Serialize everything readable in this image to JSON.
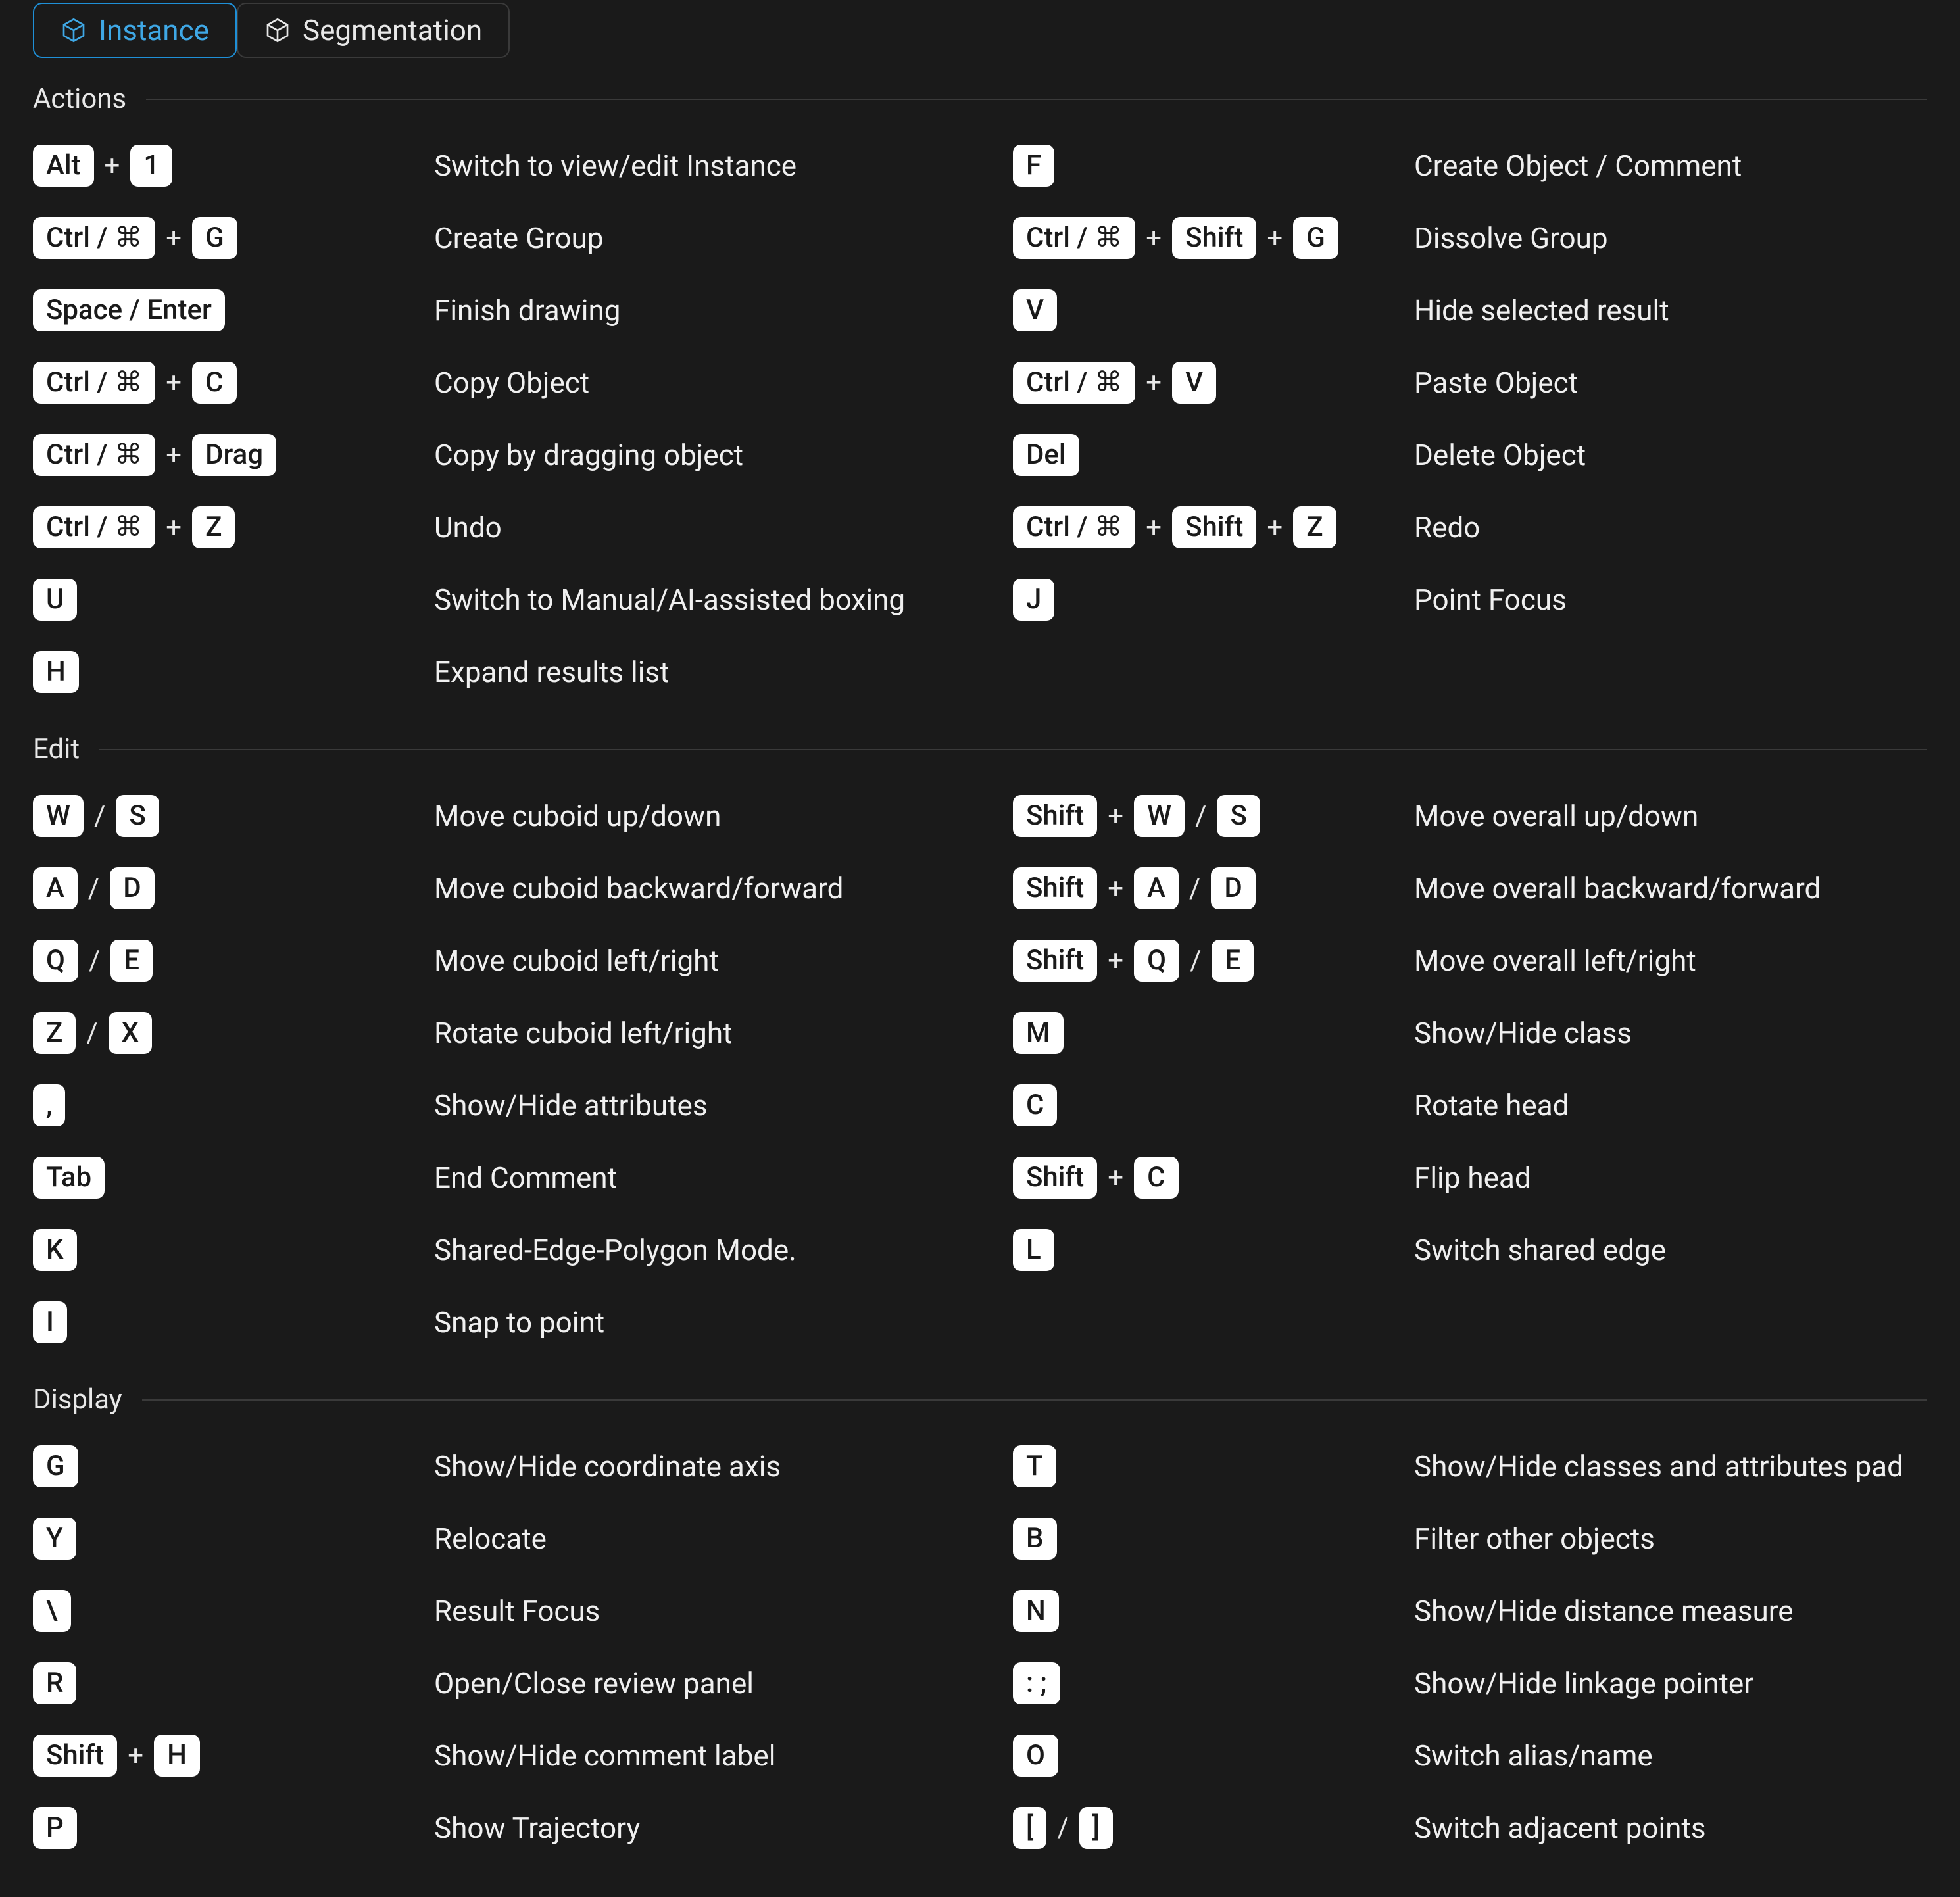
{
  "tabs": [
    {
      "id": "instance",
      "label": "Instance",
      "active": true
    },
    {
      "id": "segmentation",
      "label": "Segmentation",
      "active": false
    }
  ],
  "sections": [
    {
      "title": "Actions",
      "rows": [
        {
          "left": {
            "keys": [
              [
                "Alt"
              ],
              [
                "1"
              ]
            ],
            "seps": [
              "+"
            ]
          },
          "left_desc": "Switch to view/edit Instance",
          "right": {
            "keys": [
              [
                "F"
              ]
            ],
            "seps": []
          },
          "right_desc": "Create Object / Comment"
        },
        {
          "left": {
            "keys": [
              [
                "Ctrl / ⌘"
              ],
              [
                "G"
              ]
            ],
            "seps": [
              "+"
            ]
          },
          "left_desc": "Create Group",
          "right": {
            "keys": [
              [
                "Ctrl / ⌘"
              ],
              [
                "Shift"
              ],
              [
                "G"
              ]
            ],
            "seps": [
              "+",
              "+"
            ]
          },
          "right_desc": "Dissolve Group"
        },
        {
          "left": {
            "keys": [
              [
                "Space / Enter"
              ]
            ],
            "seps": []
          },
          "left_desc": "Finish drawing",
          "right": {
            "keys": [
              [
                "V"
              ]
            ],
            "seps": []
          },
          "right_desc": "Hide selected result"
        },
        {
          "left": {
            "keys": [
              [
                "Ctrl / ⌘"
              ],
              [
                "C"
              ]
            ],
            "seps": [
              "+"
            ]
          },
          "left_desc": "Copy Object",
          "right": {
            "keys": [
              [
                "Ctrl / ⌘"
              ],
              [
                "V"
              ]
            ],
            "seps": [
              "+"
            ]
          },
          "right_desc": "Paste Object"
        },
        {
          "left": {
            "keys": [
              [
                "Ctrl / ⌘"
              ],
              [
                "Drag"
              ]
            ],
            "seps": [
              "+"
            ]
          },
          "left_desc": "Copy by dragging object",
          "right": {
            "keys": [
              [
                "Del"
              ]
            ],
            "seps": []
          },
          "right_desc": "Delete Object"
        },
        {
          "left": {
            "keys": [
              [
                "Ctrl / ⌘"
              ],
              [
                "Z"
              ]
            ],
            "seps": [
              "+"
            ]
          },
          "left_desc": "Undo",
          "right": {
            "keys": [
              [
                "Ctrl / ⌘"
              ],
              [
                "Shift"
              ],
              [
                "Z"
              ]
            ],
            "seps": [
              "+",
              "+"
            ]
          },
          "right_desc": "Redo"
        },
        {
          "left": {
            "keys": [
              [
                "U"
              ]
            ],
            "seps": []
          },
          "left_desc": "Switch to Manual/AI-assisted boxing",
          "right": {
            "keys": [
              [
                "J"
              ]
            ],
            "seps": []
          },
          "right_desc": "Point Focus"
        },
        {
          "left": {
            "keys": [
              [
                "H"
              ]
            ],
            "seps": []
          },
          "left_desc": "Expand results list",
          "right": null,
          "right_desc": null
        }
      ]
    },
    {
      "title": "Edit",
      "rows": [
        {
          "left": {
            "keys": [
              [
                "W"
              ],
              [
                "S"
              ]
            ],
            "seps": [
              "/"
            ]
          },
          "left_desc": "Move cuboid up/down",
          "right": {
            "keys": [
              [
                "Shift"
              ],
              [
                "W"
              ],
              [
                "S"
              ]
            ],
            "seps": [
              "+",
              "/"
            ]
          },
          "right_desc": "Move overall up/down"
        },
        {
          "left": {
            "keys": [
              [
                "A"
              ],
              [
                "D"
              ]
            ],
            "seps": [
              "/"
            ]
          },
          "left_desc": "Move cuboid backward/forward",
          "right": {
            "keys": [
              [
                "Shift"
              ],
              [
                "A"
              ],
              [
                "D"
              ]
            ],
            "seps": [
              "+",
              "/"
            ]
          },
          "right_desc": "Move overall backward/forward"
        },
        {
          "left": {
            "keys": [
              [
                "Q"
              ],
              [
                "E"
              ]
            ],
            "seps": [
              "/"
            ]
          },
          "left_desc": "Move cuboid left/right",
          "right": {
            "keys": [
              [
                "Shift"
              ],
              [
                "Q"
              ],
              [
                "E"
              ]
            ],
            "seps": [
              "+",
              "/"
            ]
          },
          "right_desc": "Move overall left/right"
        },
        {
          "left": {
            "keys": [
              [
                "Z"
              ],
              [
                "X"
              ]
            ],
            "seps": [
              "/"
            ]
          },
          "left_desc": "Rotate cuboid left/right",
          "right": {
            "keys": [
              [
                "M"
              ]
            ],
            "seps": []
          },
          "right_desc": "Show/Hide class"
        },
        {
          "left": {
            "keys": [
              [
                ","
              ]
            ],
            "seps": []
          },
          "left_desc": "Show/Hide attributes",
          "right": {
            "keys": [
              [
                "C"
              ]
            ],
            "seps": []
          },
          "right_desc": "Rotate head"
        },
        {
          "left": {
            "keys": [
              [
                "Tab"
              ]
            ],
            "seps": []
          },
          "left_desc": "End Comment",
          "right": {
            "keys": [
              [
                "Shift"
              ],
              [
                "C"
              ]
            ],
            "seps": [
              "+"
            ]
          },
          "right_desc": "Flip head"
        },
        {
          "left": {
            "keys": [
              [
                "K"
              ]
            ],
            "seps": []
          },
          "left_desc": "Shared-Edge-Polygon Mode.",
          "right": {
            "keys": [
              [
                "L"
              ]
            ],
            "seps": []
          },
          "right_desc": "Switch shared edge"
        },
        {
          "left": {
            "keys": [
              [
                "I"
              ]
            ],
            "seps": []
          },
          "left_desc": "Snap to point",
          "right": null,
          "right_desc": null
        }
      ]
    },
    {
      "title": "Display",
      "rows": [
        {
          "left": {
            "keys": [
              [
                "G"
              ]
            ],
            "seps": []
          },
          "left_desc": "Show/Hide coordinate axis",
          "right": {
            "keys": [
              [
                "T"
              ]
            ],
            "seps": []
          },
          "right_desc": "Show/Hide classes and attributes pad"
        },
        {
          "left": {
            "keys": [
              [
                "Y"
              ]
            ],
            "seps": []
          },
          "left_desc": "Relocate",
          "right": {
            "keys": [
              [
                "B"
              ]
            ],
            "seps": []
          },
          "right_desc": "Filter other objects"
        },
        {
          "left": {
            "keys": [
              [
                "\\"
              ]
            ],
            "seps": []
          },
          "left_desc": "Result Focus",
          "right": {
            "keys": [
              [
                "N"
              ]
            ],
            "seps": []
          },
          "right_desc": "Show/Hide distance measure"
        },
        {
          "left": {
            "keys": [
              [
                "R"
              ]
            ],
            "seps": []
          },
          "left_desc": "Open/Close review panel",
          "right": {
            "keys": [
              [
                ": ;"
              ]
            ],
            "seps": []
          },
          "right_desc": "Show/Hide linkage pointer"
        },
        {
          "left": {
            "keys": [
              [
                "Shift"
              ],
              [
                "H"
              ]
            ],
            "seps": [
              "+"
            ]
          },
          "left_desc": "Show/Hide comment label",
          "right": {
            "keys": [
              [
                "O"
              ]
            ],
            "seps": []
          },
          "right_desc": "Switch alias/name"
        },
        {
          "left": {
            "keys": [
              [
                "P"
              ]
            ],
            "seps": []
          },
          "left_desc": "Show Trajectory",
          "right": {
            "keys": [
              [
                "["
              ],
              [
                "]"
              ]
            ],
            "seps": [
              "/"
            ]
          },
          "right_desc": "Switch adjacent points"
        }
      ]
    }
  ]
}
